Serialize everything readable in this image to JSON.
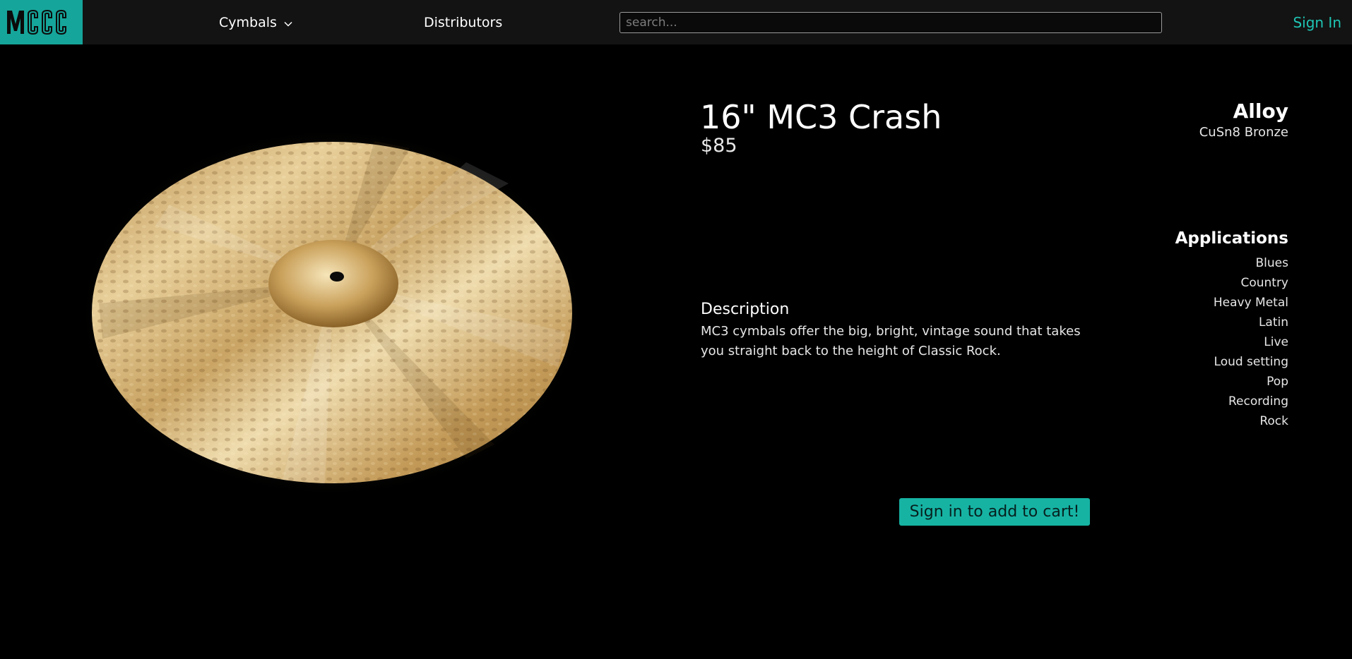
{
  "brand": {
    "logo_text": "MCCC",
    "accent_color": "#16a59a"
  },
  "nav": {
    "cymbals_label": "Cymbals",
    "cymbals_icon": "chevron-down-icon",
    "distributors_label": "Distributors",
    "search_placeholder": "search...",
    "search_value": "",
    "signin_label": "Sign In",
    "link_color": "#1fc5b4"
  },
  "product": {
    "title": "16\" MC3 Crash",
    "price": "$85",
    "image": "cymbal-image",
    "description_heading": "Description",
    "description_text": "MC3 cymbals offer the big, bright, vintage sound that takes you straight back to the height of Classic Rock.",
    "alloy_heading": "Alloy",
    "alloy_value": "CuSn8 Bronze",
    "applications_heading": "Applications",
    "applications": [
      "Blues",
      "Country",
      "Heavy Metal",
      "Latin",
      "Live",
      "Loud setting",
      "Pop",
      "Recording",
      "Rock"
    ],
    "cart_button_label": "Sign in to add to cart!"
  }
}
